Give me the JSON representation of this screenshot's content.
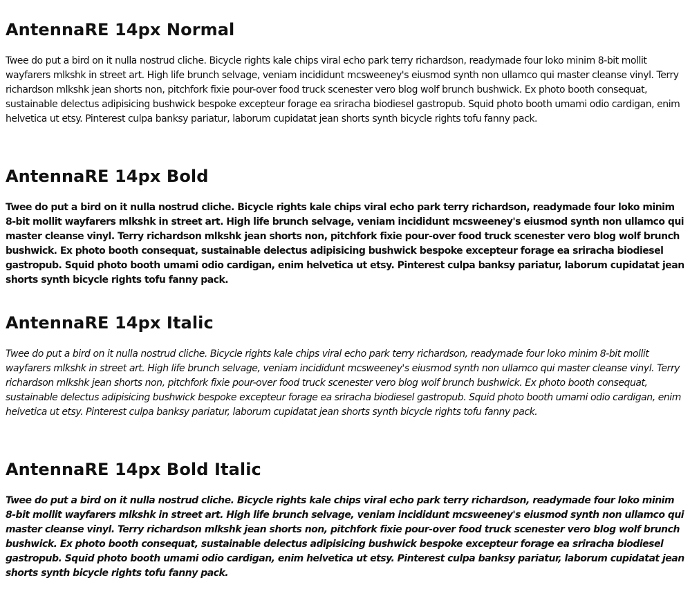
{
  "sections": [
    {
      "heading": "AntennaRE 14px Normal",
      "body": "Twee do put a bird on it nulla nostrud cliche. Bicycle rights kale chips viral echo park terry richardson, readymade four loko minim 8-bit mollit wayfarers mlkshk in street art. High life brunch selvage, veniam incididunt mcsweeney's eiusmod synth non ullamco qui master cleanse vinyl. Terry richardson mlkshk jean shorts non, pitchfork fixie pour-over food truck scenester vero blog wolf brunch bushwick. Ex photo booth consequat, sustainable delectus adipisicing bushwick bespoke excepteur forage ea sriracha biodiesel gastropub. Squid photo booth umami odio cardigan, enim helvetica ut etsy. Pinterest culpa banksy pariatur, laborum cupidatat jean shorts synth bicycle rights tofu fanny pack."
    },
    {
      "heading": "AntennaRE 14px Bold",
      "body": "Twee do put a bird on it nulla nostrud cliche. Bicycle rights kale chips viral echo park terry richardson, readymade four loko minim 8-bit mollit wayfarers mlkshk in street art. High life brunch selvage, veniam incididunt mcsweeney's eiusmod synth non ullamco qui master cleanse vinyl. Terry richardson mlkshk jean shorts non, pitchfork fixie pour-over food truck scenester vero blog wolf brunch bushwick. Ex photo booth consequat, sustainable delectus adipisicing bushwick bespoke excepteur forage ea sriracha biodiesel gastropub. Squid photo booth umami odio cardigan, enim helvetica ut etsy. Pinterest culpa banksy pariatur, laborum cupidatat jean shorts synth bicycle rights tofu fanny pack."
    },
    {
      "heading": "AntennaRE 14px Italic",
      "body": "Twee do put a bird on it nulla nostrud cliche. Bicycle rights kale chips viral echo park terry richardson, readymade four loko minim 8-bit mollit wayfarers mlkshk in street art. High life brunch selvage, veniam incididunt mcsweeney's eiusmod synth non ullamco qui master cleanse vinyl. Terry richardson mlkshk jean shorts non, pitchfork fixie pour-over food truck scenester vero blog wolf brunch bushwick. Ex photo booth consequat, sustainable delectus adipisicing bushwick bespoke excepteur forage ea sriracha biodiesel gastropub. Squid photo booth umami odio cardigan, enim helvetica ut etsy. Pinterest culpa banksy pariatur, laborum cupidatat jean shorts synth bicycle rights tofu fanny pack."
    },
    {
      "heading": "AntennaRE 14px Bold Italic",
      "body": "Twee do put a bird on it nulla nostrud cliche. Bicycle rights kale chips viral echo park terry richardson, readymade four loko minim 8-bit mollit wayfarers mlkshk in street art. High life brunch selvage, veniam incididunt mcsweeney's eiusmod synth non ullamco qui master cleanse vinyl. Terry richardson mlkshk jean shorts non, pitchfork fixie pour-over food truck scenester vero blog wolf brunch bushwick. Ex photo booth consequat, sustainable delectus adipisicing bushwick bespoke excepteur forage ea sriracha biodiesel gastropub. Squid photo booth umami odio cardigan, enim helvetica ut etsy. Pinterest culpa banksy pariatur, laborum cupidatat jean shorts synth bicycle rights tofu fanny pack."
    }
  ],
  "colors": {
    "text": "#111111",
    "background": "#ffffff"
  }
}
